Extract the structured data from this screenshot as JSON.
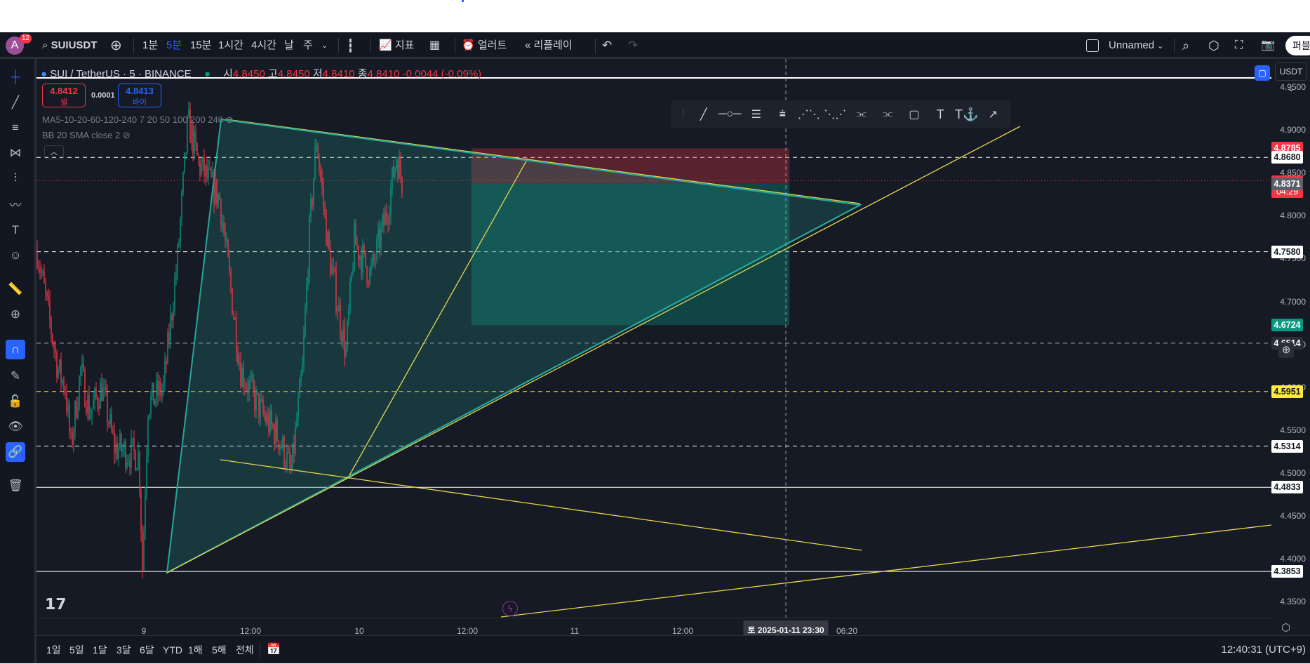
{
  "header": {
    "avatar_letter": "A",
    "notification_count": "12",
    "symbol": "SUIUSDT",
    "intervals": [
      "1분",
      "5분",
      "15분",
      "1시간",
      "4시간",
      "날",
      "주"
    ],
    "active_interval": "5분",
    "indicators_label": "지표",
    "alert_label": "얼러트",
    "replay_label": "리플레이",
    "layout_name": "Unnamed",
    "publish_label": "퍼블"
  },
  "legend": {
    "title": "SUI / TetherUS · 5 · BINANCE",
    "o_label": "시",
    "o": "4.8450",
    "h_label": "고",
    "h": "4.8450",
    "l_label": "저",
    "l": "4.8410",
    "c_label": "종",
    "c": "4.8410",
    "change": "-0.0044 (-0.09%)",
    "sell_price": "4.8412",
    "sell_label": "셀",
    "spread": "0.0001",
    "buy_price": "4.8413",
    "buy_label": "바이",
    "indicator1": "MA5-10-20-60-120-240 7 20 50 100 200 240",
    "indicator2": "BB 20 SMA close 2"
  },
  "price_axis": {
    "currency": "USDT",
    "ticks": [
      "4.9500",
      "4.9000",
      "4.8500",
      "4.8000",
      "4.7500",
      "4.7000",
      "4.6500",
      "4.6000",
      "4.5500",
      "4.5000",
      "4.4500",
      "4.4000",
      "4.3500"
    ],
    "badges": [
      {
        "text": "4.8785",
        "price": 4.8785,
        "bg": "#f23645",
        "fg": "#ffffff"
      },
      {
        "text": "4.8680",
        "price": 4.868,
        "bg": "#ffffff",
        "fg": "#131722"
      },
      {
        "text": "4.8410",
        "price": 4.841,
        "bg": "#f23645",
        "fg": "#ffffff",
        "sub": "04:29"
      },
      {
        "text": "4.8371",
        "price": 4.8371,
        "bg": "#5d606b",
        "fg": "#ffffff"
      },
      {
        "text": "4.7580",
        "price": 4.758,
        "bg": "#ffffff",
        "fg": "#131722"
      },
      {
        "text": "4.6724",
        "price": 4.6724,
        "bg": "#089981",
        "fg": "#ffffff"
      },
      {
        "text": "4.6514",
        "price": 4.6514,
        "bg": "#2a2e39",
        "fg": "#ffffff"
      },
      {
        "text": "4.5951",
        "price": 4.5951,
        "bg": "#ffeb3b",
        "fg": "#131722"
      },
      {
        "text": "4.5314",
        "price": 4.5314,
        "bg": "#ffffff",
        "fg": "#131722"
      },
      {
        "text": "4.4833",
        "price": 4.4833,
        "bg": "#ffffff",
        "fg": "#131722"
      },
      {
        "text": "4.3853",
        "price": 4.3853,
        "bg": "#ffffff",
        "fg": "#131722"
      }
    ]
  },
  "time_axis": {
    "ticks": [
      "9",
      "12:00",
      "10",
      "12:00",
      "11",
      "12:00",
      "06:20"
    ],
    "crosshair_label": "토 2025-01-11  23:30"
  },
  "bottom": {
    "ranges": [
      "1일",
      "5일",
      "1달",
      "3달",
      "6달",
      "YTD",
      "1해",
      "5해",
      "전체"
    ],
    "clock": "12:40:31 (UTC+9)"
  },
  "colors": {
    "bg": "#161a25",
    "up": "#089981",
    "down": "#f23645",
    "accent": "#2962ff",
    "drawing_yellow": "#e6d84a",
    "drawing_teal": "#26a69a"
  }
}
